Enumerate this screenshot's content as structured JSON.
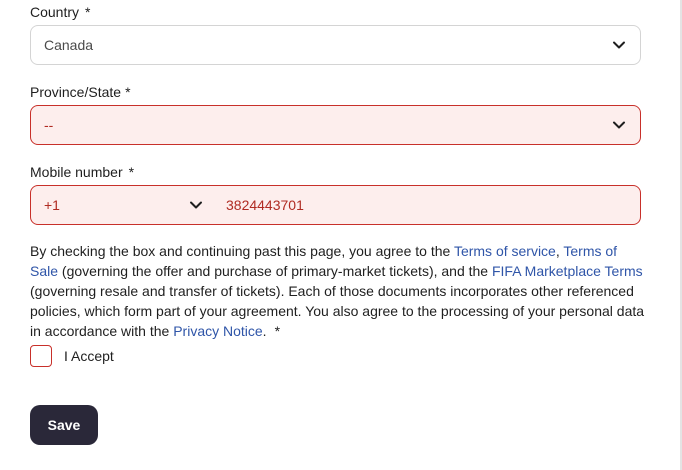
{
  "country": {
    "label": "Country",
    "required_mark": "*",
    "value": "Canada"
  },
  "province": {
    "label": "Province/State",
    "required_mark": "*",
    "value": "--"
  },
  "mobile": {
    "label": "Mobile number",
    "required_mark": "*",
    "country_code": "+1",
    "number": "3824443701"
  },
  "terms": {
    "text_1": "By checking the box and continuing past this page, you agree to the ",
    "link_terms_of_service": "Terms of service",
    "text_2": ", ",
    "link_terms_of_sale": "Terms of Sale",
    "text_3": " (governing the offer and purchase of primary-market tickets), and the ",
    "link_marketplace_terms": "FIFA Marketplace Terms",
    "text_4": " (governing resale and transfer of tickets). Each of those documents incorporates other referenced policies, which form part of your agreement. You also agree to the processing of your personal data in accordance with the ",
    "link_privacy_notice": "Privacy Notice",
    "text_5": ".",
    "required_mark": "*"
  },
  "accept": {
    "label": "I Accept",
    "checked": false
  },
  "save_label": "Save",
  "colors": {
    "error_border": "#c8302a",
    "error_fill": "#fdeeed",
    "link": "#2f55a8",
    "button": "#2a2839"
  },
  "icons": {
    "dropdown": "chevron-down-icon"
  }
}
